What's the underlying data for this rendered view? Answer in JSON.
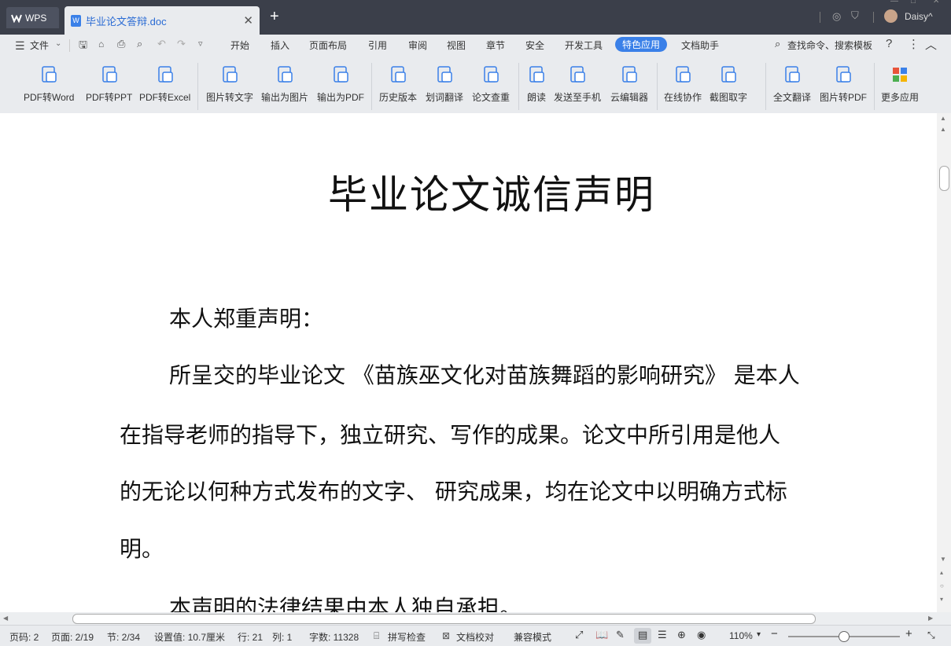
{
  "titlebar": {
    "app_tab": "WPS",
    "doc_tab": "毕业论文答辩.doc",
    "user": "Daisy^"
  },
  "menu": {
    "file": "文件",
    "tabs": [
      "开始",
      "插入",
      "页面布局",
      "引用",
      "审阅",
      "视图",
      "章节",
      "安全",
      "开发工具",
      "特色应用",
      "文档助手"
    ],
    "active": "特色应用",
    "search": "查找命令、搜索模板"
  },
  "ribbon": {
    "buttons": [
      "PDF转Word",
      "PDF转PPT",
      "PDF转Excel",
      "图片转文字",
      "输出为图片",
      "输出为PDF",
      "历史版本",
      "划词翻译",
      "论文查重",
      "朗读",
      "发送至手机",
      "云编辑器",
      "在线协作",
      "截图取字",
      "全文翻译",
      "图片转PDF",
      "更多应用"
    ]
  },
  "document": {
    "title": "毕业论文诚信声明",
    "lines": [
      "本人郑重声明：",
      "所呈交的毕业论文 《苗族巫文化对苗族舞蹈的影响研究》  是本人",
      "在指导老师的指导下，独立研究、写作的成果。论文中所引用是他人",
      "的无论以何种方式发布的文字、  研究成果，均在论文中以明确方式标",
      "明。",
      "本声明的法律结果由本人独自承担。"
    ]
  },
  "status": {
    "page_code": "页码: 2",
    "page": "页面: 2/19",
    "section": "节: 2/34",
    "setting": "设置值: 10.7厘米",
    "row": "行: 21",
    "col": "列: 1",
    "words": "字数: 11328",
    "spell": "拼写检查",
    "proof": "文档校对",
    "compat": "兼容模式",
    "zoom": "110%",
    "zoom_level_percent": 110
  },
  "colors": {
    "accent": "#3a80e8",
    "titlebar": "#3b3f4a"
  }
}
